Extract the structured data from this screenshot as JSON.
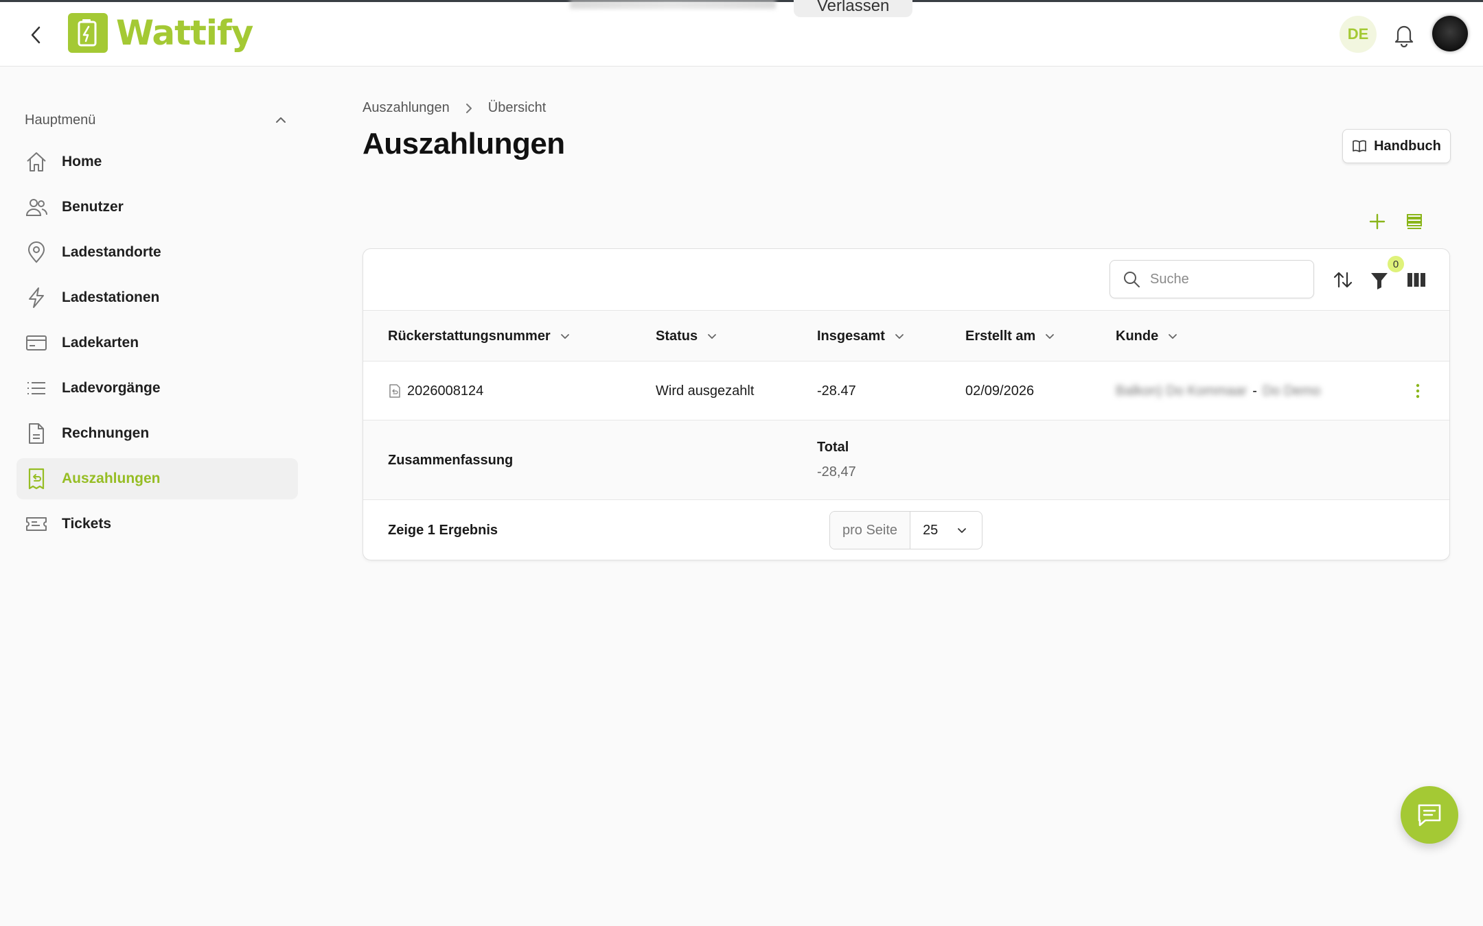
{
  "app": {
    "name": "Wattify",
    "accent_color": "#a4c934",
    "top_banner_label": "Verlassen",
    "language": "DE"
  },
  "sidebar": {
    "header": "Hauptmenü",
    "items": [
      {
        "label": "Home",
        "icon": "home-icon"
      },
      {
        "label": "Benutzer",
        "icon": "users-icon"
      },
      {
        "label": "Ladestandorte",
        "icon": "map-pin-icon"
      },
      {
        "label": "Ladestationen",
        "icon": "lightning-icon"
      },
      {
        "label": "Ladekarten",
        "icon": "card-icon"
      },
      {
        "label": "Ladevorgänge",
        "icon": "list-icon"
      },
      {
        "label": "Rechnungen",
        "icon": "document-icon"
      },
      {
        "label": "Auszahlungen",
        "icon": "refund-icon",
        "active": true
      },
      {
        "label": "Tickets",
        "icon": "ticket-icon"
      }
    ]
  },
  "breadcrumb": [
    "Auszahlungen",
    "Übersicht"
  ],
  "page": {
    "title": "Auszahlungen",
    "manual_button": "Handbuch"
  },
  "toolbar": {
    "search_placeholder": "Suche",
    "filter_count": "0"
  },
  "table": {
    "columns": [
      "Rückerstattungsnummer",
      "Status",
      "Insgesamt",
      "Erstellt am",
      "Kunde"
    ],
    "rows": [
      {
        "number": "2026008124",
        "status": "Wird ausgezahlt",
        "total": "-28.47",
        "created": "02/09/2026",
        "customer_name": "Balkon) Do Kommaar",
        "customer_sep": "-",
        "customer_org": "Do Demo"
      }
    ],
    "summary": {
      "label": "Zusammenfassung",
      "total_label": "Total",
      "total_value": "-28,47"
    }
  },
  "pagination": {
    "result_text": "Zeige 1 Ergebnis",
    "per_page_label": "pro Seite",
    "per_page_value": "25"
  }
}
